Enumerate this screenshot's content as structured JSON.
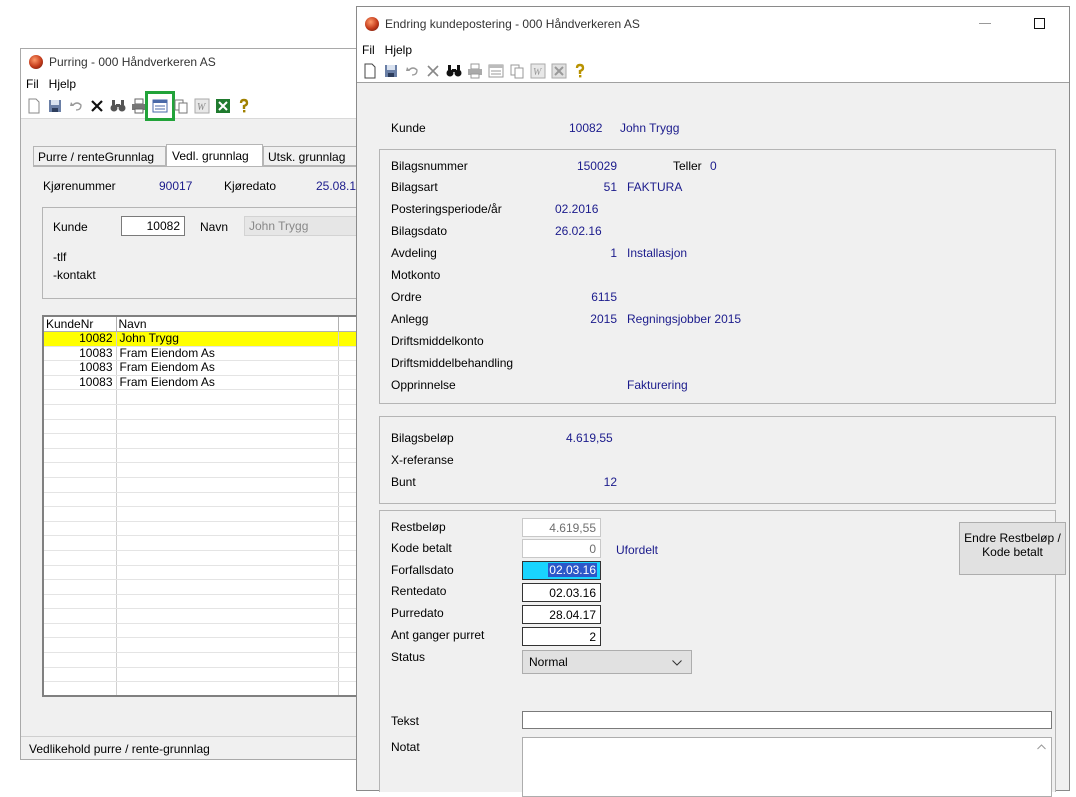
{
  "purring": {
    "title": "Purring - 000 Håndverkeren AS",
    "menu": [
      "Fil",
      "Hjelp"
    ],
    "tabs": [
      "Purre / renteGrunnlag",
      "Vedl. grunnlag",
      "Utsk. grunnlag"
    ],
    "run_label": "Kjørenummer",
    "run_value": "90017",
    "date_label": "Kjøredato",
    "date_value": "25.08.1",
    "customer_label": "Kunde",
    "customer_value": "10082",
    "name_label": "Navn",
    "name_value": "John Trygg",
    "tlf_label": "-tlf",
    "kontakt_label": "-kontakt",
    "list_headers": [
      "KundeNr",
      "Navn"
    ],
    "rows": [
      {
        "nr": "10082",
        "navn": "John Trygg"
      },
      {
        "nr": "10083",
        "navn": "Fram Eiendom As"
      },
      {
        "nr": "10083",
        "navn": "Fram Eiendom As"
      },
      {
        "nr": "10083",
        "navn": "Fram Eiendom As"
      }
    ],
    "status_text": "Vedlikehold purre / rente-grunnlag",
    "highlight_color": "#ffff00",
    "focus_box_color": "#22a33a"
  },
  "endring": {
    "title": "Endring kundepostering - 000 Håndverkeren AS",
    "menu": [
      "Fil",
      "Hjelp"
    ],
    "kunde_label": "Kunde",
    "kunde_nr": "10082",
    "kunde_navn": "John Trygg",
    "bilagsnummer_label": "Bilagsnummer",
    "bilagsnummer_value": "150029",
    "teller_label": "Teller",
    "teller_value": "0",
    "bilagsart_label": "Bilagsart",
    "bilagsart_value": "51",
    "bilagsart_text": "FAKTURA",
    "periode_label": "Posteringsperiode/år",
    "periode_value": "02.2016",
    "bilagsdato_label": "Bilagsdato",
    "bilagsdato_value": "26.02.16",
    "avdeling_label": "Avdeling",
    "avdeling_value": "1",
    "avdeling_text": "Installasjon",
    "motkonto_label": "Motkonto",
    "ordre_label": "Ordre",
    "ordre_value": "6115",
    "anlegg_label": "Anlegg",
    "anlegg_value": "2015",
    "anlegg_text": "Regningsjobber 2015",
    "driftsmiddelkonto_label": "Driftsmiddelkonto",
    "driftsmiddelbehandling_label": "Driftsmiddelbehandling",
    "opprinnelse_label": "Opprinnelse",
    "opprinnelse_value": "Fakturering",
    "bilagsbelop_label": "Bilagsbeløp",
    "bilagsbelop_value": "4.619,55",
    "xref_label": "X-referanse",
    "bunt_label": "Bunt",
    "bunt_value": "12",
    "restbelop_label": "Restbeløp",
    "restbelop_value": "4.619,55",
    "kode_betalt_label": "Kode betalt",
    "kode_betalt_value": "0",
    "kode_betalt_text": "Ufordelt",
    "forfallsdato_label": "Forfallsdato",
    "forfallsdato_value": "02.03.16",
    "rentedato_label": "Rentedato",
    "rentedato_value": "02.03.16",
    "purredato_label": "Purredato",
    "purredato_value": "28.04.17",
    "ant_label": "Ant ganger purret",
    "ant_value": "2",
    "status_label": "Status",
    "status_value": "Normal",
    "endre_button": "Endre Restbeløp / Kode betalt",
    "tekst_label": "Tekst",
    "notat_label": "Notat",
    "selection_color": "#19d4ff"
  }
}
